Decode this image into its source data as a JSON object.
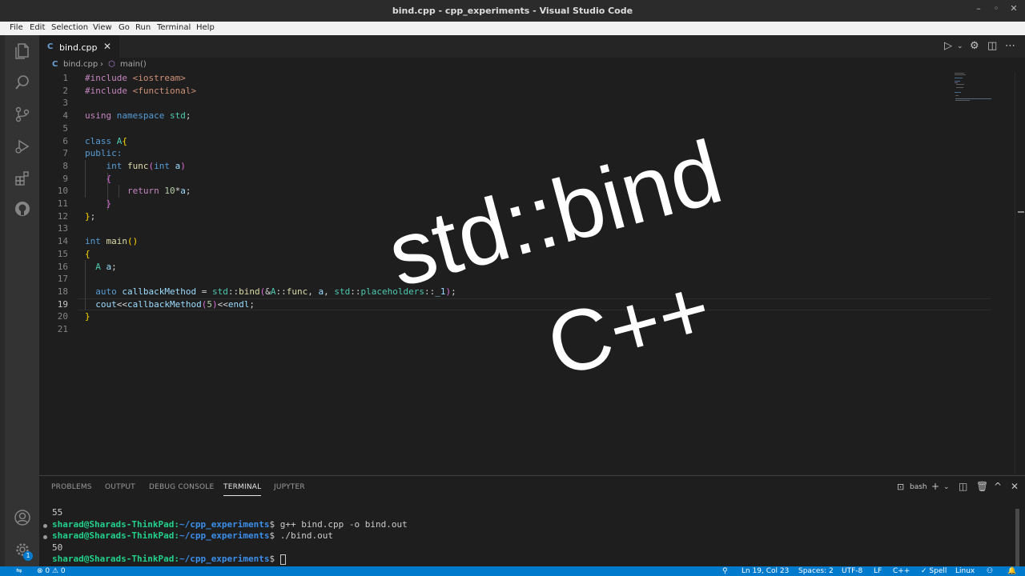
{
  "window": {
    "title": "bind.cpp - cpp_experiments - Visual Studio Code",
    "controls": [
      "–",
      "◦",
      "✕"
    ]
  },
  "menu": [
    "File",
    "Edit",
    "Selection",
    "View",
    "Go",
    "Run",
    "Terminal",
    "Help"
  ],
  "tab": {
    "icon": "C",
    "label": "bind.cpp",
    "close": "✕"
  },
  "breadcrumb": {
    "file": "bind.cpp",
    "sep": "›",
    "symbol": "main()"
  },
  "editor": {
    "active_line": 19,
    "line_numbers": [
      "1",
      "2",
      "3",
      "4",
      "5",
      "6",
      "7",
      "8",
      "9",
      "10",
      "11",
      "12",
      "13",
      "14",
      "15",
      "16",
      "17",
      "18",
      "19",
      "20",
      "21"
    ]
  },
  "overlay": {
    "line1": "std::bind",
    "line2": "C++"
  },
  "panel": {
    "tabs": [
      "PROBLEMS",
      "OUTPUT",
      "DEBUG CONSOLE",
      "TERMINAL",
      "JUPYTER"
    ],
    "active_tab": "TERMINAL",
    "shell": "bash"
  },
  "terminal": {
    "lines": [
      {
        "prompt": "",
        "path": "",
        "text": "55"
      },
      {
        "prompt": "sharad@Sharads-ThinkPad:",
        "path": "~/cpp_experiments",
        "text": "$ g++ bind.cpp -o bind.out"
      },
      {
        "prompt": "sharad@Sharads-ThinkPad:",
        "path": "~/cpp_experiments",
        "text": "$ ./bind.out"
      },
      {
        "prompt": "",
        "path": "",
        "text": "50"
      },
      {
        "prompt": "sharad@Sharads-ThinkPad:",
        "path": "~/cpp_experiments",
        "text": "$ "
      }
    ]
  },
  "status": {
    "errors": "⊗ 0 ⚠ 0",
    "position": "Ln 19, Col 23",
    "spaces": "Spaces: 2",
    "encoding": "UTF-8",
    "eol": "LF",
    "language": "C++",
    "spell": "✓ Spell",
    "platform": "Linux",
    "settings_badge": "1"
  },
  "colors": {
    "accent": "#007acc",
    "editor_bg": "#1e1e1e",
    "prompt_green": "#23d18b",
    "path_blue": "#3b8eea"
  }
}
